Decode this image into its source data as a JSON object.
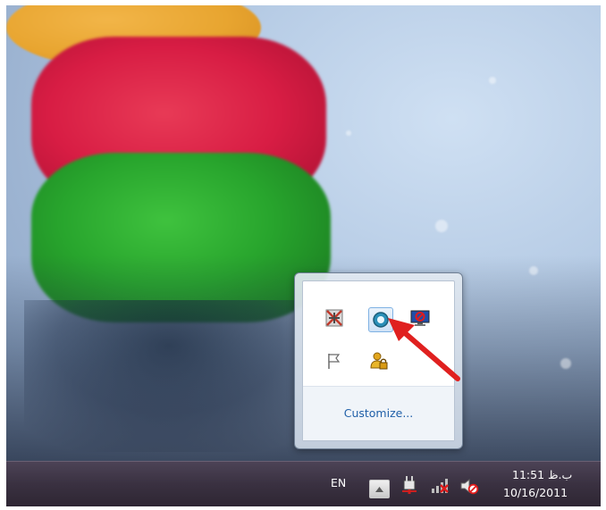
{
  "overflow": {
    "icons": [
      {
        "name": "network-crossed-icon",
        "row": 1,
        "col": 1
      },
      {
        "name": "camera-circle-icon",
        "row": 1,
        "col": 2
      },
      {
        "name": "monitor-blocked-icon",
        "row": 1,
        "col": 3
      },
      {
        "name": "action-center-flag-icon",
        "row": 2,
        "col": 1
      },
      {
        "name": "user-lock-icon",
        "row": 2,
        "col": 2
      }
    ],
    "customize_label": "Customize..."
  },
  "taskbar": {
    "language": "EN",
    "time": "11:51 ب.ظ",
    "date": "10/16/2011",
    "icons": [
      "show-hidden-icons-icon",
      "power-plug-icon",
      "network-disconnected-icon",
      "volume-muted-icon"
    ]
  },
  "colors": {
    "taskbar": "#3a3141",
    "link": "#1f5fa8",
    "arrow": "#e0201f"
  }
}
